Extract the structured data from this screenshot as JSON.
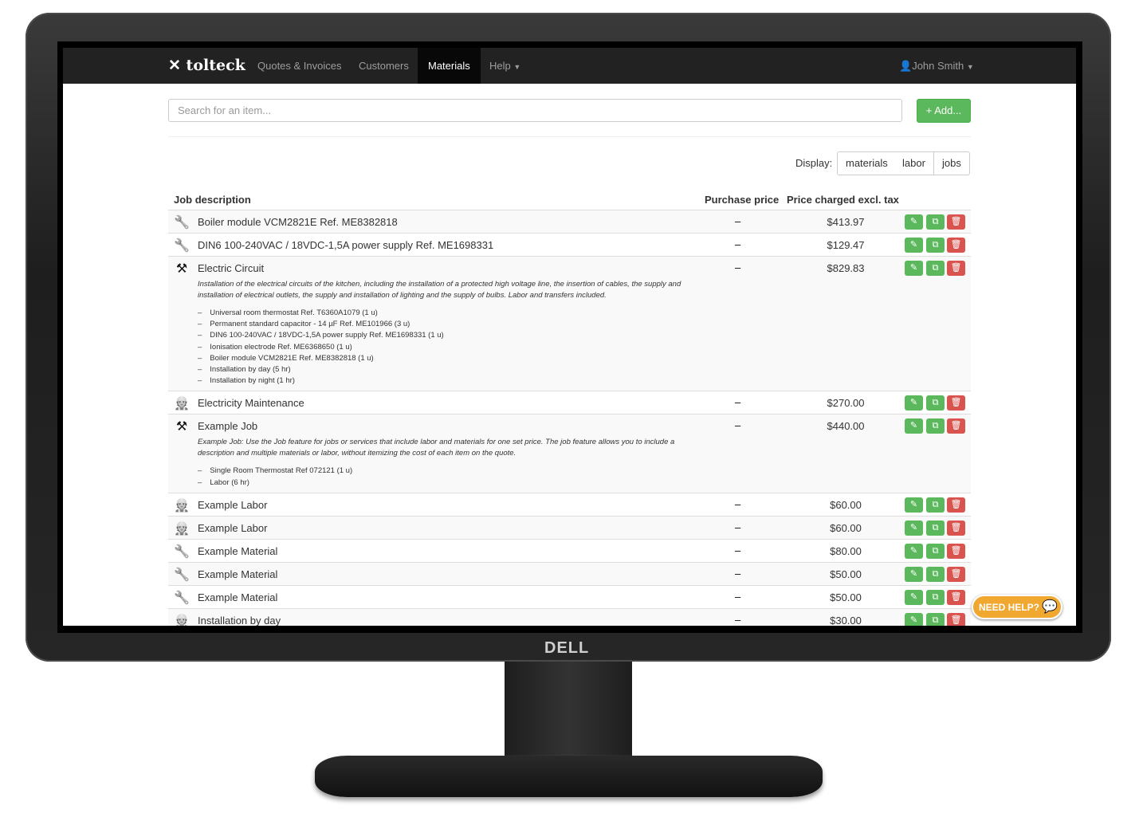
{
  "brand": "DELL",
  "nav": {
    "logo": "tolteck",
    "items": [
      {
        "label": "Quotes & Invoices"
      },
      {
        "label": "Customers"
      },
      {
        "label": "Materials",
        "active": true
      },
      {
        "label": "Help"
      }
    ],
    "user": "John Smith"
  },
  "search": {
    "placeholder": "Search for an item..."
  },
  "add_label": "+ Add...",
  "display": {
    "label": "Display:",
    "options": [
      "materials",
      "labor",
      "jobs"
    ]
  },
  "table": {
    "headers": [
      "Job description",
      "Purchase price",
      "Price charged excl. tax"
    ],
    "rows": [
      {
        "type": "material",
        "name": "Boiler module VCM2821E Ref. ME8382818",
        "purchase": "–",
        "price": "$413.97"
      },
      {
        "type": "material",
        "name": "DIN6 100-240VAC / 18VDC-1,5A power supply Ref. ME1698331",
        "purchase": "–",
        "price": "$129.47"
      },
      {
        "type": "job",
        "name": "Electric Circuit",
        "purchase": "–",
        "price": "$829.83",
        "description": "Installation of the electrical circuits of the kitchen, including the installation of a protected high voltage line, the insertion of cables, the supply and installation of electrical outlets, the supply and installation of lighting and the supply of bulbs. Labor and transfers included.",
        "items": [
          "Universal room thermostat Ref. T6360A1079 (1 u)",
          "Permanent standard capacitor - 14 µF Ref. ME101966 (3 u)",
          "DIN6 100-240VAC / 18VDC-1,5A power supply Ref. ME1698331 (1 u)",
          "Ionisation electrode Ref. ME6368650 (1 u)",
          "Boiler module VCM2821E Ref. ME8382818 (1 u)",
          "Installation by day (5 hr)",
          "Installation by night (1 hr)"
        ]
      },
      {
        "type": "labor",
        "name": "Electricity Maintenance",
        "purchase": "–",
        "price": "$270.00"
      },
      {
        "type": "job",
        "name": "Example Job",
        "purchase": "–",
        "price": "$440.00",
        "description": "Example Job: Use the Job feature for jobs or services that include labor and materials for one set price. The job feature allows you to include a description and multiple materials or labor, without itemizing the cost of each item on the quote.",
        "items": [
          "Single Room Thermostat Ref 072121 (1 u)",
          "Labor (6 hr)"
        ]
      },
      {
        "type": "labor",
        "name": "Example Labor",
        "purchase": "–",
        "price": "$60.00"
      },
      {
        "type": "labor",
        "name": "Example Labor",
        "purchase": "–",
        "price": "$60.00"
      },
      {
        "type": "material",
        "name": "Example Material",
        "purchase": "–",
        "price": "$80.00"
      },
      {
        "type": "material",
        "name": "Example Material",
        "purchase": "–",
        "price": "$50.00"
      },
      {
        "type": "material",
        "name": "Example Material",
        "purchase": "–",
        "price": "$50.00"
      },
      {
        "type": "labor",
        "name": "Installation by day",
        "purchase": "–",
        "price": "$30.00"
      },
      {
        "type": "labor",
        "name": "",
        "purchase": "",
        "price": ""
      }
    ]
  },
  "help": "NEED HELP?",
  "colors": {
    "success": "#5cb85c",
    "danger": "#d9534f",
    "navbar": "#222222",
    "help": "#f0a830"
  }
}
